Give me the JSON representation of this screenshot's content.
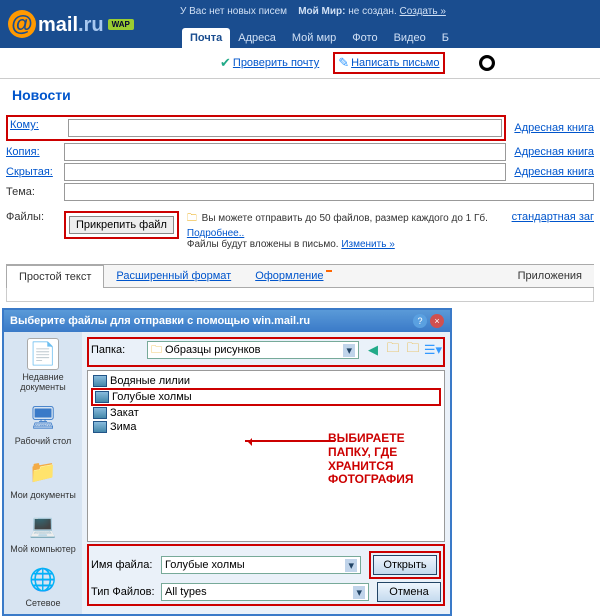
{
  "header": {
    "logo_text": "mail",
    "logo_domain": ".ru",
    "wap": "WAP",
    "no_mail": "У Вас нет новых писем",
    "my_world_prefix": "Мой Мир:",
    "my_world_status": "не создан.",
    "my_world_create": "Создать »"
  },
  "tabs": [
    {
      "label": "Почта",
      "active": true
    },
    {
      "label": "Адреса"
    },
    {
      "label": "Мой мир"
    },
    {
      "label": "Фото"
    },
    {
      "label": "Видео"
    },
    {
      "label": "Б"
    }
  ],
  "subtoolbar": {
    "check_mail": "Проверить почту",
    "write_letter": "Написать письмо"
  },
  "news_label": "Новости",
  "compose": {
    "to": "Кому:",
    "copy": "Копия:",
    "hidden": "Скрытая:",
    "subject": "Тема:",
    "files": "Файлы:",
    "addr_book": "Адресная книга",
    "attach_btn": "Прикрепить файл",
    "attach_note_1": "Вы можете отправить до 50 файлов, размер каждого до 1 Гб.",
    "attach_note_more": "Подробнее..",
    "attach_note_2": "Файлы будут вложены в письмо.",
    "attach_note_change": "Изменить »",
    "std_link": "стандартная заг"
  },
  "format_tabs": {
    "plain": "Простой текст",
    "extended": "Расширенный формат",
    "design": "Оформление",
    "attachments": "Приложения"
  },
  "dialog": {
    "title": "Выберите файлы для отправки с помощью win.mail.ru",
    "folder_label": "Папка:",
    "folder_value": "Образцы рисунков",
    "files": [
      "Водяные лилии",
      "Голубые холмы",
      "Закат",
      "Зима"
    ],
    "selected_index": 1,
    "sidebar": [
      "Недавние документы",
      "Рабочий стол",
      "Мои документы",
      "Мой компьютер",
      "Сетевое"
    ],
    "callout": "ВЫБИРАЕТЕ ПАПКУ, ГДЕ ХРАНИТСЯ ФОТОГРАФИЯ",
    "filename_label": "Имя файла:",
    "filename_value": "Голубые холмы",
    "filetype_label": "Тип Файлов:",
    "filetype_value": "All types",
    "open_btn": "Открыть",
    "cancel_btn": "Отмена"
  }
}
